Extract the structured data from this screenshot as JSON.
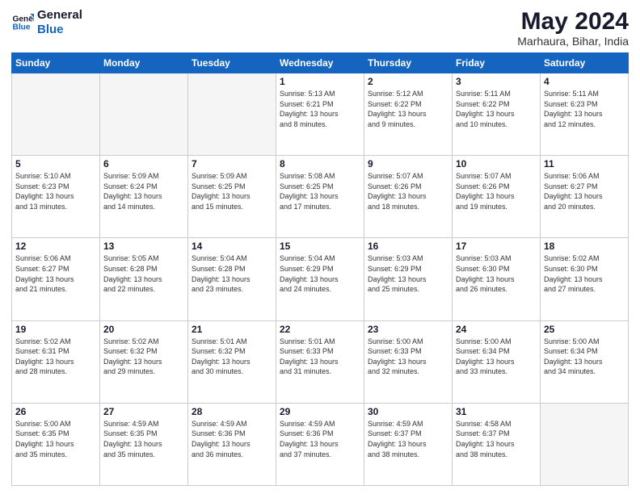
{
  "logo": {
    "line1": "General",
    "line2": "Blue"
  },
  "title": "May 2024",
  "subtitle": "Marhaura, Bihar, India",
  "weekdays": [
    "Sunday",
    "Monday",
    "Tuesday",
    "Wednesday",
    "Thursday",
    "Friday",
    "Saturday"
  ],
  "weeks": [
    [
      {
        "day": "",
        "info": ""
      },
      {
        "day": "",
        "info": ""
      },
      {
        "day": "",
        "info": ""
      },
      {
        "day": "1",
        "info": "Sunrise: 5:13 AM\nSunset: 6:21 PM\nDaylight: 13 hours\nand 8 minutes."
      },
      {
        "day": "2",
        "info": "Sunrise: 5:12 AM\nSunset: 6:22 PM\nDaylight: 13 hours\nand 9 minutes."
      },
      {
        "day": "3",
        "info": "Sunrise: 5:11 AM\nSunset: 6:22 PM\nDaylight: 13 hours\nand 10 minutes."
      },
      {
        "day": "4",
        "info": "Sunrise: 5:11 AM\nSunset: 6:23 PM\nDaylight: 13 hours\nand 12 minutes."
      }
    ],
    [
      {
        "day": "5",
        "info": "Sunrise: 5:10 AM\nSunset: 6:23 PM\nDaylight: 13 hours\nand 13 minutes."
      },
      {
        "day": "6",
        "info": "Sunrise: 5:09 AM\nSunset: 6:24 PM\nDaylight: 13 hours\nand 14 minutes."
      },
      {
        "day": "7",
        "info": "Sunrise: 5:09 AM\nSunset: 6:25 PM\nDaylight: 13 hours\nand 15 minutes."
      },
      {
        "day": "8",
        "info": "Sunrise: 5:08 AM\nSunset: 6:25 PM\nDaylight: 13 hours\nand 17 minutes."
      },
      {
        "day": "9",
        "info": "Sunrise: 5:07 AM\nSunset: 6:26 PM\nDaylight: 13 hours\nand 18 minutes."
      },
      {
        "day": "10",
        "info": "Sunrise: 5:07 AM\nSunset: 6:26 PM\nDaylight: 13 hours\nand 19 minutes."
      },
      {
        "day": "11",
        "info": "Sunrise: 5:06 AM\nSunset: 6:27 PM\nDaylight: 13 hours\nand 20 minutes."
      }
    ],
    [
      {
        "day": "12",
        "info": "Sunrise: 5:06 AM\nSunset: 6:27 PM\nDaylight: 13 hours\nand 21 minutes."
      },
      {
        "day": "13",
        "info": "Sunrise: 5:05 AM\nSunset: 6:28 PM\nDaylight: 13 hours\nand 22 minutes."
      },
      {
        "day": "14",
        "info": "Sunrise: 5:04 AM\nSunset: 6:28 PM\nDaylight: 13 hours\nand 23 minutes."
      },
      {
        "day": "15",
        "info": "Sunrise: 5:04 AM\nSunset: 6:29 PM\nDaylight: 13 hours\nand 24 minutes."
      },
      {
        "day": "16",
        "info": "Sunrise: 5:03 AM\nSunset: 6:29 PM\nDaylight: 13 hours\nand 25 minutes."
      },
      {
        "day": "17",
        "info": "Sunrise: 5:03 AM\nSunset: 6:30 PM\nDaylight: 13 hours\nand 26 minutes."
      },
      {
        "day": "18",
        "info": "Sunrise: 5:02 AM\nSunset: 6:30 PM\nDaylight: 13 hours\nand 27 minutes."
      }
    ],
    [
      {
        "day": "19",
        "info": "Sunrise: 5:02 AM\nSunset: 6:31 PM\nDaylight: 13 hours\nand 28 minutes."
      },
      {
        "day": "20",
        "info": "Sunrise: 5:02 AM\nSunset: 6:32 PM\nDaylight: 13 hours\nand 29 minutes."
      },
      {
        "day": "21",
        "info": "Sunrise: 5:01 AM\nSunset: 6:32 PM\nDaylight: 13 hours\nand 30 minutes."
      },
      {
        "day": "22",
        "info": "Sunrise: 5:01 AM\nSunset: 6:33 PM\nDaylight: 13 hours\nand 31 minutes."
      },
      {
        "day": "23",
        "info": "Sunrise: 5:00 AM\nSunset: 6:33 PM\nDaylight: 13 hours\nand 32 minutes."
      },
      {
        "day": "24",
        "info": "Sunrise: 5:00 AM\nSunset: 6:34 PM\nDaylight: 13 hours\nand 33 minutes."
      },
      {
        "day": "25",
        "info": "Sunrise: 5:00 AM\nSunset: 6:34 PM\nDaylight: 13 hours\nand 34 minutes."
      }
    ],
    [
      {
        "day": "26",
        "info": "Sunrise: 5:00 AM\nSunset: 6:35 PM\nDaylight: 13 hours\nand 35 minutes."
      },
      {
        "day": "27",
        "info": "Sunrise: 4:59 AM\nSunset: 6:35 PM\nDaylight: 13 hours\nand 35 minutes."
      },
      {
        "day": "28",
        "info": "Sunrise: 4:59 AM\nSunset: 6:36 PM\nDaylight: 13 hours\nand 36 minutes."
      },
      {
        "day": "29",
        "info": "Sunrise: 4:59 AM\nSunset: 6:36 PM\nDaylight: 13 hours\nand 37 minutes."
      },
      {
        "day": "30",
        "info": "Sunrise: 4:59 AM\nSunset: 6:37 PM\nDaylight: 13 hours\nand 38 minutes."
      },
      {
        "day": "31",
        "info": "Sunrise: 4:58 AM\nSunset: 6:37 PM\nDaylight: 13 hours\nand 38 minutes."
      },
      {
        "day": "",
        "info": ""
      }
    ]
  ]
}
